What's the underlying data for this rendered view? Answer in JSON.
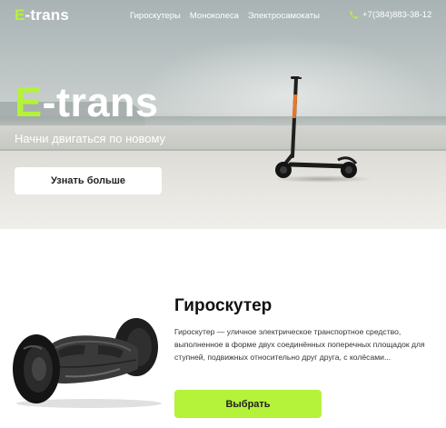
{
  "header": {
    "logo_accent": "E",
    "logo_rest": "-trans",
    "nav": [
      {
        "label": "Гироскутеры"
      },
      {
        "label": "Моноколеса"
      },
      {
        "label": "Электросамокаты"
      }
    ],
    "phone": "+7(384)883-38-12",
    "phone_icon": "phone-icon"
  },
  "hero": {
    "title_accent": "E",
    "title_rest": "-trans",
    "subtitle": "Начни двигаться по новому",
    "button_label": "Узнать больше",
    "image": "electric-scooter"
  },
  "product": {
    "title": "Гироскутер",
    "description": "Гироскутер — уличное электрическое транспортное средство, выполненное в форме двух соединённых поперечных площадок для ступней, подвижных относительно друг друга, с колёсами...",
    "button_label": "Выбрать",
    "image": "hoverboard"
  },
  "colors": {
    "accent": "#b5f23a",
    "text_dark": "#111111",
    "white": "#ffffff"
  }
}
